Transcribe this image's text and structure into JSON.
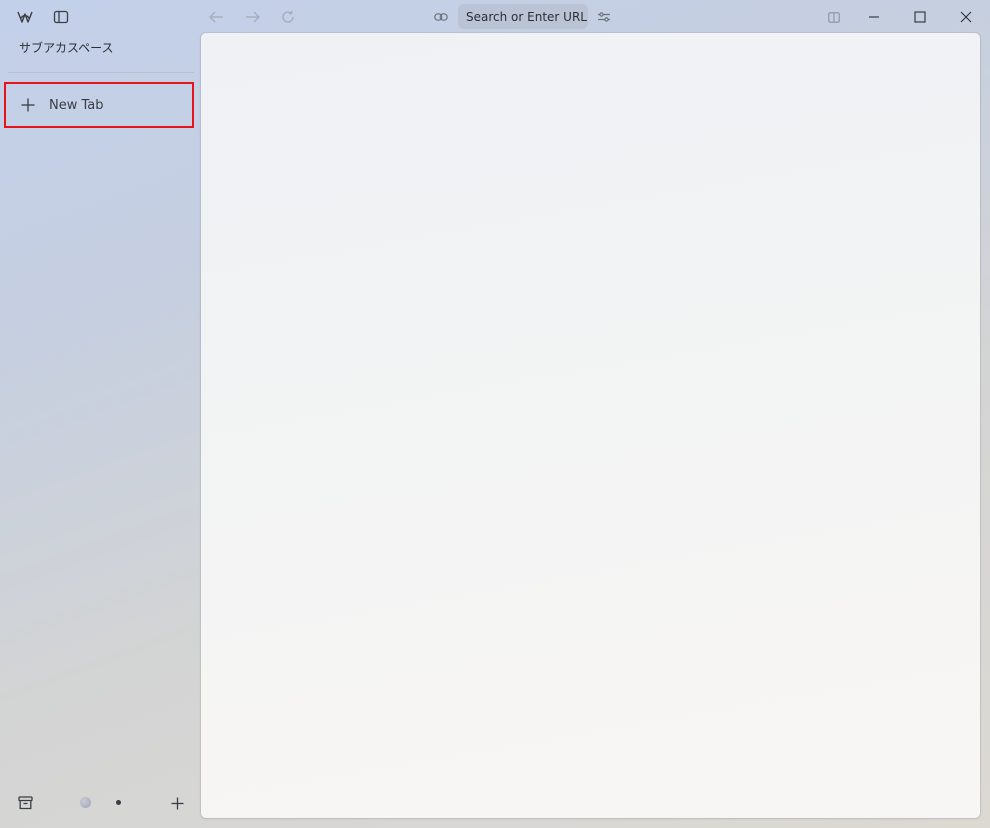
{
  "sidebar": {
    "workspace_title": "サブアカスペース",
    "new_tab_label": "New Tab",
    "top_icons": [
      "zen-logo-icon",
      "sidebar-toggle-icon"
    ],
    "bottom_icons": [
      "archive-icon",
      "workspace-globe-icon",
      "workspace-dot-icon",
      "add-workspace-icon"
    ]
  },
  "toolbar": {
    "url_placeholder": "Search or Enter URL...",
    "nav_icons": [
      "back-arrow-icon",
      "forward-arrow-icon",
      "reload-icon"
    ],
    "url_icons": [
      "link-icon",
      "site-settings-icon"
    ]
  },
  "window_controls": {
    "icons": [
      "split-view-icon",
      "minimize-icon",
      "maximize-icon",
      "close-icon"
    ]
  },
  "colors": {
    "highlight": "#e8141c",
    "content_bg": "#f3f4f4"
  }
}
